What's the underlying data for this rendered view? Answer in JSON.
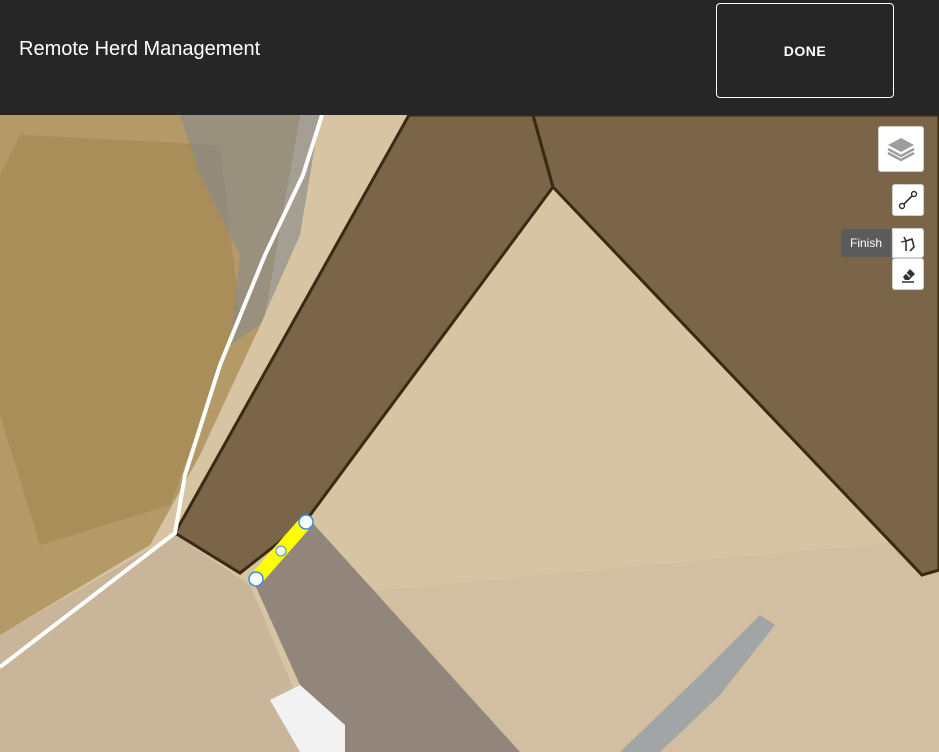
{
  "header": {
    "title": "Remote Herd Management",
    "done_label": "DONE"
  },
  "map": {
    "layers_control": {
      "icon": "layers-icon"
    },
    "draw_line_control": {
      "icon": "polyline-icon"
    },
    "finish_control": {
      "icon": "hand-pointer-icon",
      "tooltip": "Finish"
    },
    "erase_control": {
      "icon": "eraser-icon"
    },
    "colors": {
      "paddock_fill": "#6b553a",
      "paddock_border": "#3a2a12",
      "fence_line": "#ffffff",
      "drawn_segment": "#ffff00",
      "vertex_fill": "#ffffff",
      "vertex_stroke": "#3a8ee6"
    }
  }
}
